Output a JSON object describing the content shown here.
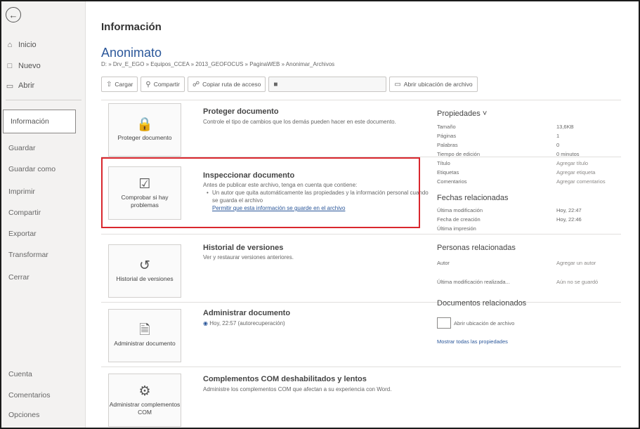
{
  "nav": {
    "top": [
      {
        "label": "Inicio",
        "icon": "home-icon"
      },
      {
        "label": "Nuevo",
        "icon": "new-doc-icon"
      },
      {
        "label": "Abrir",
        "icon": "folder-icon"
      }
    ],
    "items": [
      "Información",
      "Guardar",
      "Guardar como",
      "Imprimir",
      "Compartir",
      "Exportar",
      "Transformar",
      "Cerrar"
    ],
    "bottom": [
      "Cuenta",
      "Comentarios",
      "Opciones"
    ]
  },
  "page": {
    "title": "Información",
    "doc_name": "Anonimato",
    "doc_path": "D: » Drv_E_EGO » Equipos_CCEA » 2013_GEOFOCUS » PaginaWEB » Anonimar_Archivos"
  },
  "actions": [
    {
      "label": "Cargar",
      "icon": "upload-icon",
      "enabled": true
    },
    {
      "label": "Compartir",
      "icon": "share-icon",
      "enabled": true
    },
    {
      "label": "Copiar ruta de acceso",
      "icon": "copy-path-icon",
      "enabled": true
    },
    {
      "label": "Abrir ubicación de archivo",
      "icon": "folder-open-icon",
      "enabled": true
    }
  ],
  "sections": {
    "protect": {
      "tile": "Proteger documento",
      "title": "Proteger documento",
      "desc": "Controle el tipo de cambios que los demás pueden hacer en este documento."
    },
    "inspect": {
      "tile": "Comprobar si hay problemas",
      "title": "Inspeccionar documento",
      "desc": "Antes de publicar este archivo, tenga en cuenta que contiene:",
      "bullet": "Un autor que quita automáticamente las propiedades y la información personal cuando se guarda el archivo",
      "link": "Permitir que esta información se guarde en el archivo"
    },
    "versions": {
      "tile": "Historial de versiones",
      "title": "Historial de versiones",
      "desc": "Ver y restaurar versiones anteriores."
    },
    "manage": {
      "tile": "Administrar documento",
      "title": "Administrar documento",
      "item": "Hoy, 22:57 (autorecuperación)"
    },
    "com": {
      "tile": "Administrar complementos COM",
      "title": "Complementos COM deshabilitados y lentos",
      "desc": "Administre los complementos COM que afectan a su experiencia con Word."
    }
  },
  "properties": {
    "heading": "Propiedades",
    "rows": [
      {
        "k": "Tamaño",
        "v": "13,6KB"
      },
      {
        "k": "Páginas",
        "v": "1"
      },
      {
        "k": "Palabras",
        "v": "0"
      },
      {
        "k": "Tiempo de edición",
        "v": "0 minutos"
      },
      {
        "k": "Título",
        "v": "Agregar título"
      },
      {
        "k": "Etiquetas",
        "v": "Agregar etiqueta"
      },
      {
        "k": "Comentarios",
        "v": "Agregar comentarios"
      }
    ],
    "dates_heading": "Fechas relacionadas",
    "dates": [
      {
        "k": "Última modificación",
        "v": "Hoy, 22:47"
      },
      {
        "k": "Fecha de creación",
        "v": "Hoy, 22:46"
      },
      {
        "k": "Última impresión",
        "v": ""
      }
    ],
    "people_heading": "Personas relacionadas",
    "people": [
      {
        "k": "Autor",
        "v": "Agregar un autor"
      },
      {
        "k": "Última modificación realizada...",
        "v": "Aún no se guardó"
      }
    ],
    "docs_heading": "Documentos relacionados",
    "open_location": "Abrir ubicación de archivo",
    "show_all": "Mostrar todas las propiedades"
  }
}
